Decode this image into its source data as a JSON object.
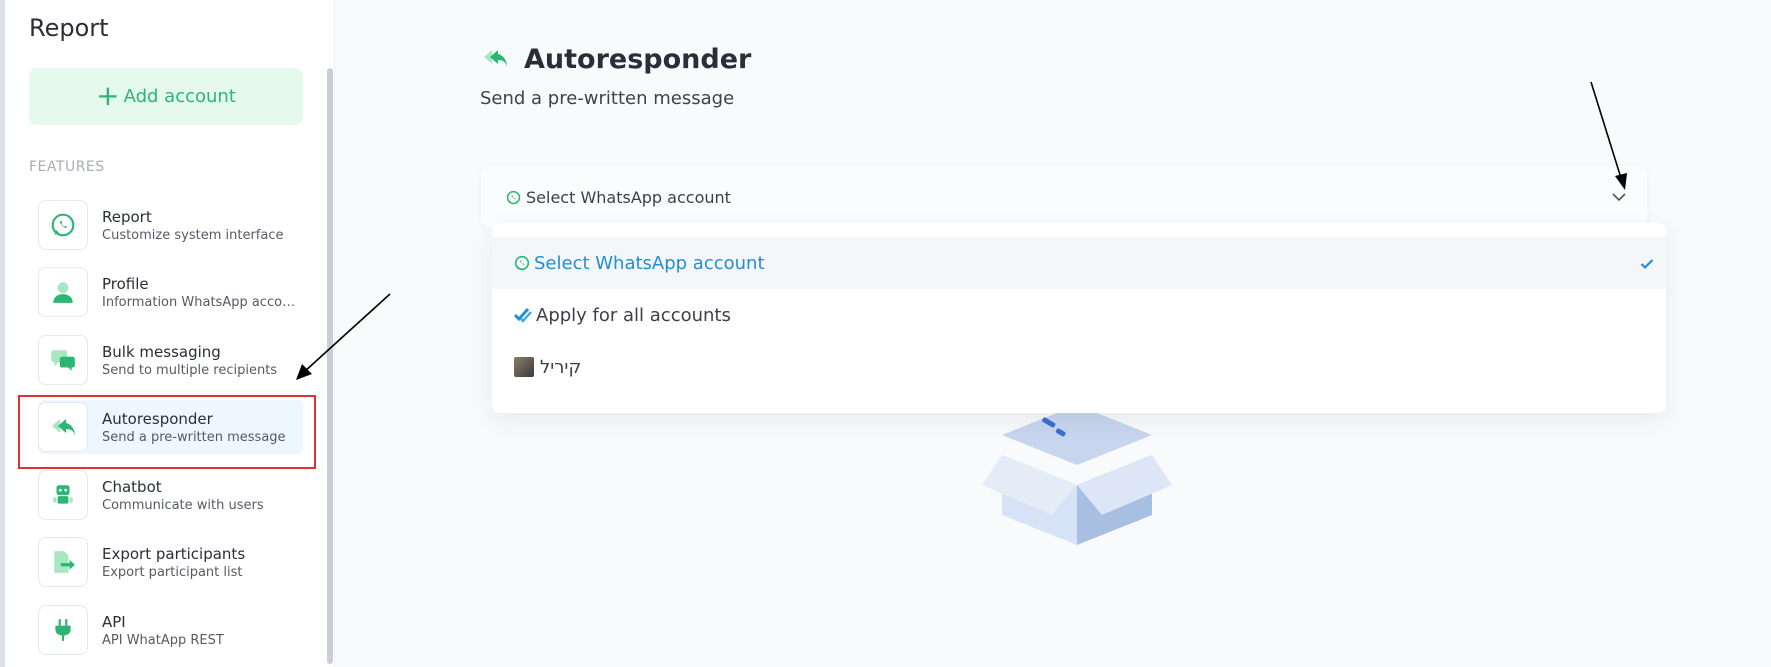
{
  "sidebar": {
    "title": "Report",
    "add_account": "Add account",
    "section_label": "FEATURES",
    "items": [
      {
        "title": "Report",
        "subtitle": "Customize system interface",
        "icon": "whatsapp-icon"
      },
      {
        "title": "Profile",
        "subtitle": "Information WhatsApp account",
        "icon": "user-icon"
      },
      {
        "title": "Bulk messaging",
        "subtitle": "Send to multiple recipients",
        "icon": "chat-bubbles-icon"
      },
      {
        "title": "Autoresponder",
        "subtitle": "Send a pre-written message",
        "icon": "reply-all-icon"
      },
      {
        "title": "Chatbot",
        "subtitle": "Communicate with users",
        "icon": "robot-icon"
      },
      {
        "title": "Export participants",
        "subtitle": "Export participant list",
        "icon": "file-export-icon"
      },
      {
        "title": "API",
        "subtitle": "API WhatApp REST",
        "icon": "plug-icon"
      }
    ]
  },
  "main": {
    "title": "Autoresponder",
    "subtitle": "Send a pre-written message",
    "select": {
      "value": "Select WhatsApp account"
    },
    "dropdown": {
      "options": [
        {
          "label": "Select WhatsApp account",
          "selected": true
        },
        {
          "label": "Apply for all accounts",
          "selected": false
        },
        {
          "label": "קיריל",
          "selected": false
        }
      ]
    }
  },
  "colors": {
    "accent_green": "#2bb673",
    "selected_blue": "#1f8fd6",
    "highlight_red": "#e03131"
  }
}
